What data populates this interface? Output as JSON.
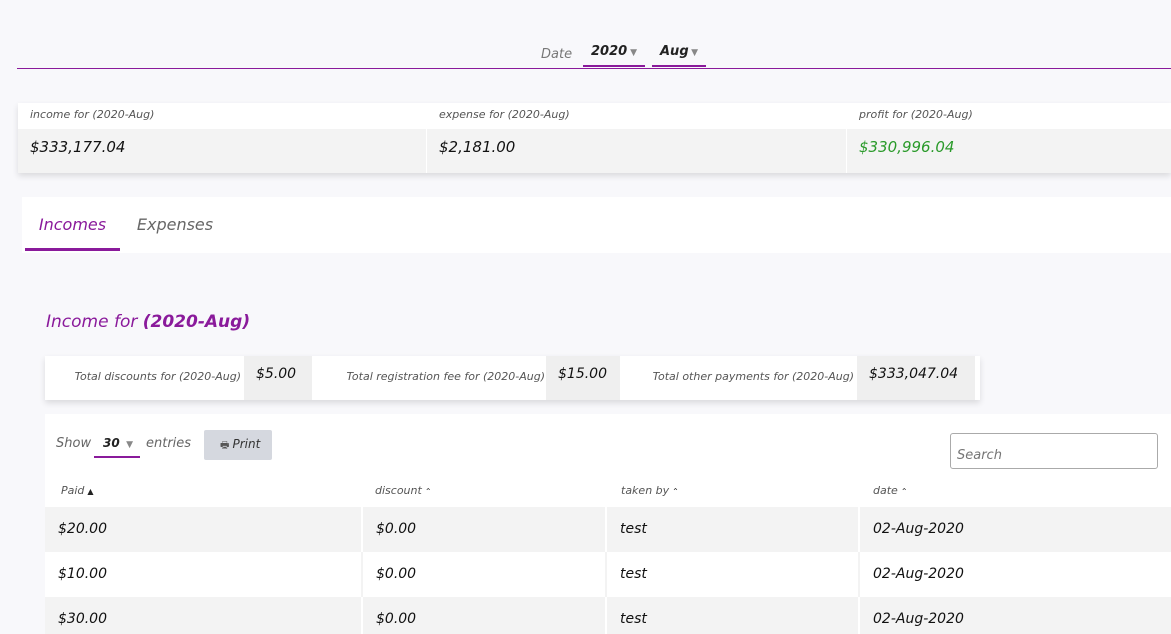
{
  "filter": {
    "date_label": "Date",
    "year_value": "2020",
    "month_value": "Aug"
  },
  "summary": {
    "income_label": "income for (2020-Aug)",
    "income_value": "$333,177.04",
    "expense_label": "expense for (2020-Aug)",
    "expense_value": "$2,181.00",
    "profit_label": "profit for (2020-Aug)",
    "profit_value": "$330,996.04",
    "profit_color": "#2a9a2a"
  },
  "tabs": [
    {
      "label": "Incomes",
      "active": true
    },
    {
      "label": "Expenses",
      "active": false
    }
  ],
  "section": {
    "title_prefix": "Income for",
    "title_period": "(2020-Aug)"
  },
  "totals": [
    {
      "label": "Total discounts for (2020-Aug)",
      "value": "$5.00"
    },
    {
      "label": "Total registration fee for (2020-Aug)",
      "value": "$15.00"
    },
    {
      "label": "Total other payments for (2020-Aug)",
      "value": "$333,047.04"
    }
  ],
  "table_controls": {
    "show_label": "Show",
    "page_length": "30",
    "entries_label": "entries",
    "print_label": "Print",
    "search_placeholder": "Search"
  },
  "table": {
    "columns": [
      "Paid",
      "discount",
      "taken by",
      "date"
    ],
    "rows": [
      [
        "$20.00",
        "$0.00",
        "test",
        "02-Aug-2020"
      ],
      [
        "$10.00",
        "$0.00",
        "test",
        "02-Aug-2020"
      ],
      [
        "$30.00",
        "$0.00",
        "test",
        "02-Aug-2020"
      ]
    ]
  },
  "colors": {
    "accent": "#8a1a9b",
    "background": "#f8f8fb"
  }
}
